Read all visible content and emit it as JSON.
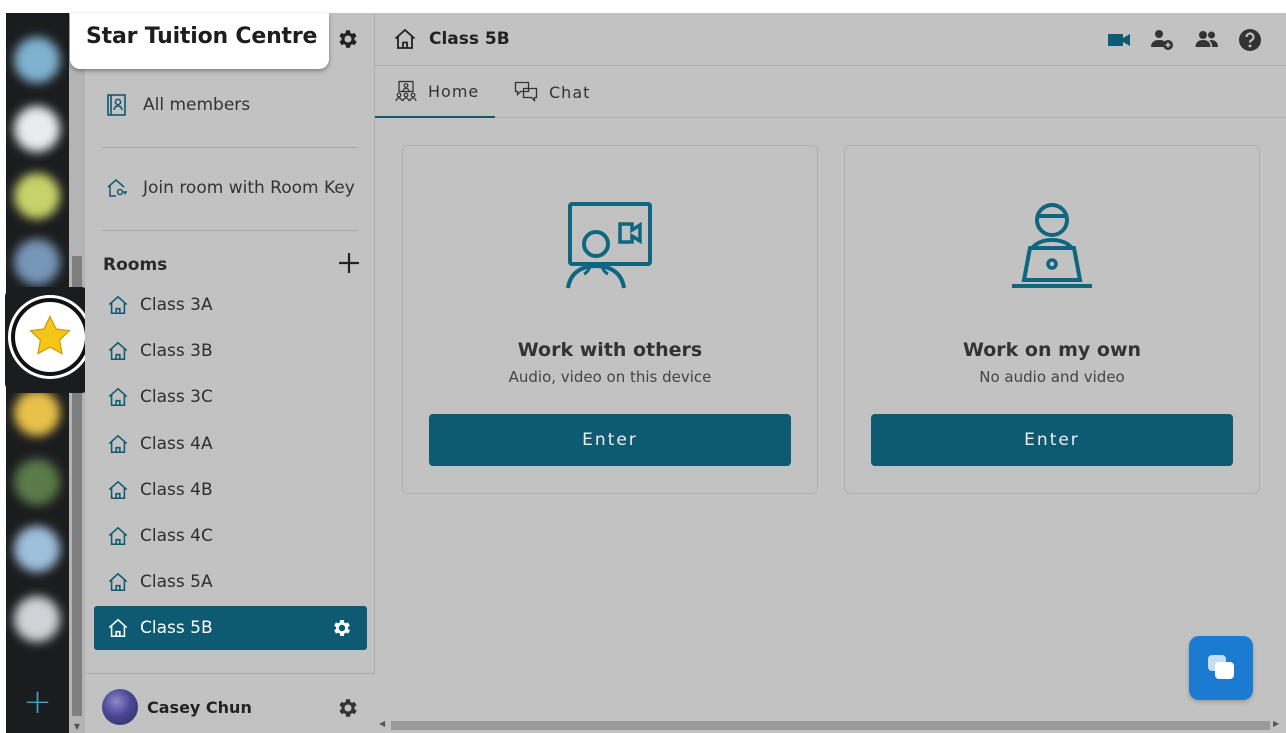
{
  "org": {
    "name": "Star Tuition Centre"
  },
  "sidebar": {
    "links": [
      {
        "label": "All members",
        "icon": "members-book-icon"
      },
      {
        "label": "Join room with Room Key",
        "icon": "room-key-icon"
      }
    ],
    "rooms_title": "Rooms",
    "rooms": [
      {
        "label": "Class 3A",
        "active": false
      },
      {
        "label": "Class 3B",
        "active": false
      },
      {
        "label": "Class 3C",
        "active": false
      },
      {
        "label": "Class 4A",
        "active": false
      },
      {
        "label": "Class 4B",
        "active": false
      },
      {
        "label": "Class 4C",
        "active": false
      },
      {
        "label": "Class 5A",
        "active": false
      },
      {
        "label": "Class 5B",
        "active": true
      }
    ]
  },
  "user": {
    "name": "Casey Chun"
  },
  "header": {
    "room_title": "Class 5B",
    "actions": [
      "video-camera-icon",
      "add-person-icon",
      "people-icon",
      "help-icon"
    ]
  },
  "tabs": [
    {
      "label": "Home",
      "icon": "people-screen-icon",
      "active": true
    },
    {
      "label": "Chat",
      "icon": "chat-bubbles-icon",
      "active": false
    }
  ],
  "cards": [
    {
      "title": "Work with others",
      "subtitle": "Audio, video on this device",
      "button": "Enter",
      "icon": "video-conference-icon"
    },
    {
      "title": "Work on my own",
      "subtitle": "No audio and video",
      "button": "Enter",
      "icon": "person-laptop-icon"
    }
  ],
  "colors": {
    "accent": "#0f5a73",
    "illustration": "#0f6680",
    "background": "#c2c2c2",
    "fab": "#1a7bd1",
    "star": "#f5c518"
  }
}
